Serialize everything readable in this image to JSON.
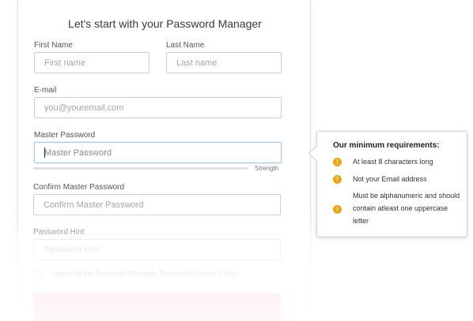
{
  "form": {
    "title": "Let's start with your Password Manager",
    "first_name": {
      "label": "First Name",
      "placeholder": "First name",
      "value": ""
    },
    "last_name": {
      "label": "Last Name",
      "placeholder": "Last name",
      "value": ""
    },
    "email": {
      "label": "E-mail",
      "placeholder": "you@youremail.com",
      "value": ""
    },
    "master_password": {
      "label": "Master Password",
      "placeholder": "Master Password",
      "value": "",
      "focused": true
    },
    "strength": {
      "label": "Strength",
      "level": 0
    },
    "confirm_password": {
      "label": "Confirm Master Password",
      "placeholder": "Confirm Master Password",
      "value": ""
    },
    "password_hint": {
      "label": "Password Hint",
      "placeholder": "Password Hint",
      "value": ""
    },
    "agreement": {
      "prefix": "I agree to the Password Manager",
      "terms_link": "Terms",
      "conjunction": "and",
      "privacy_link": "Privacy Policy",
      "checked": false
    },
    "submit": {
      "label": "",
      "color": "#ea4f47"
    }
  },
  "requirements_tooltip": {
    "title": "Our minimum requirements:",
    "icon": "exclamation-circle-icon",
    "icon_color": "#f0a70f",
    "items": [
      {
        "text": "At least 8 characters long"
      },
      {
        "text": "Not your Email address"
      },
      {
        "text": "Must be alphanumeric and should contain atleast one uppercase letter"
      }
    ]
  },
  "colors": {
    "link": "#2f7fd6",
    "focus_border": "#a8c8e8",
    "warning": "#f0a70f"
  }
}
